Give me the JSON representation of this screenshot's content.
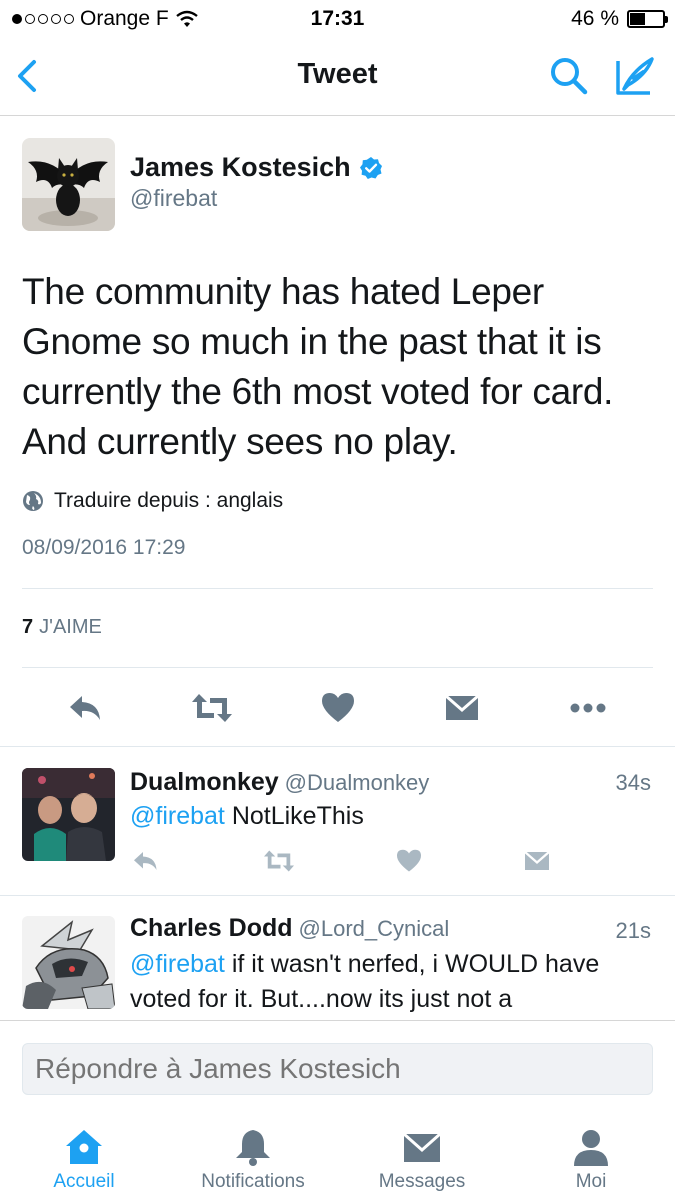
{
  "status_bar": {
    "carrier": "Orange F",
    "time": "17:31",
    "battery_text": "46 %",
    "battery_level": 0.46
  },
  "nav": {
    "title": "Tweet"
  },
  "tweet": {
    "author_name": "James Kostesich",
    "author_handle": "@firebat",
    "text": "The community has hated Leper Gnome so much in the past that it is currently the 6th most voted for card. And currently sees no play.",
    "translate_label": "Traduire depuis : anglais",
    "date": "08/09/2016 17:29",
    "likes_count": "7",
    "likes_label": "J'AIME"
  },
  "replies": [
    {
      "name": "Dualmonkey",
      "handle": "@Dualmonkey",
      "time": "34s",
      "mention": "@firebat",
      "text": " NotLikeThis"
    },
    {
      "name": "Charles Dodd",
      "handle": "@Lord_Cynical",
      "time": "21s",
      "mention": "@firebat",
      "text": " if it wasn't nerfed, i WOULD have voted for it. But....now its just not a"
    }
  ],
  "reply_box": {
    "placeholder": "Répondre à James Kostesich"
  },
  "tabs": [
    {
      "label": "Accueil",
      "active": true
    },
    {
      "label": "Notifications",
      "active": false
    },
    {
      "label": "Messages",
      "active": false
    },
    {
      "label": "Moi",
      "active": false
    }
  ],
  "colors": {
    "accent": "#1da1f2",
    "secondary_text": "#657786",
    "icon_gray": "#657786"
  }
}
